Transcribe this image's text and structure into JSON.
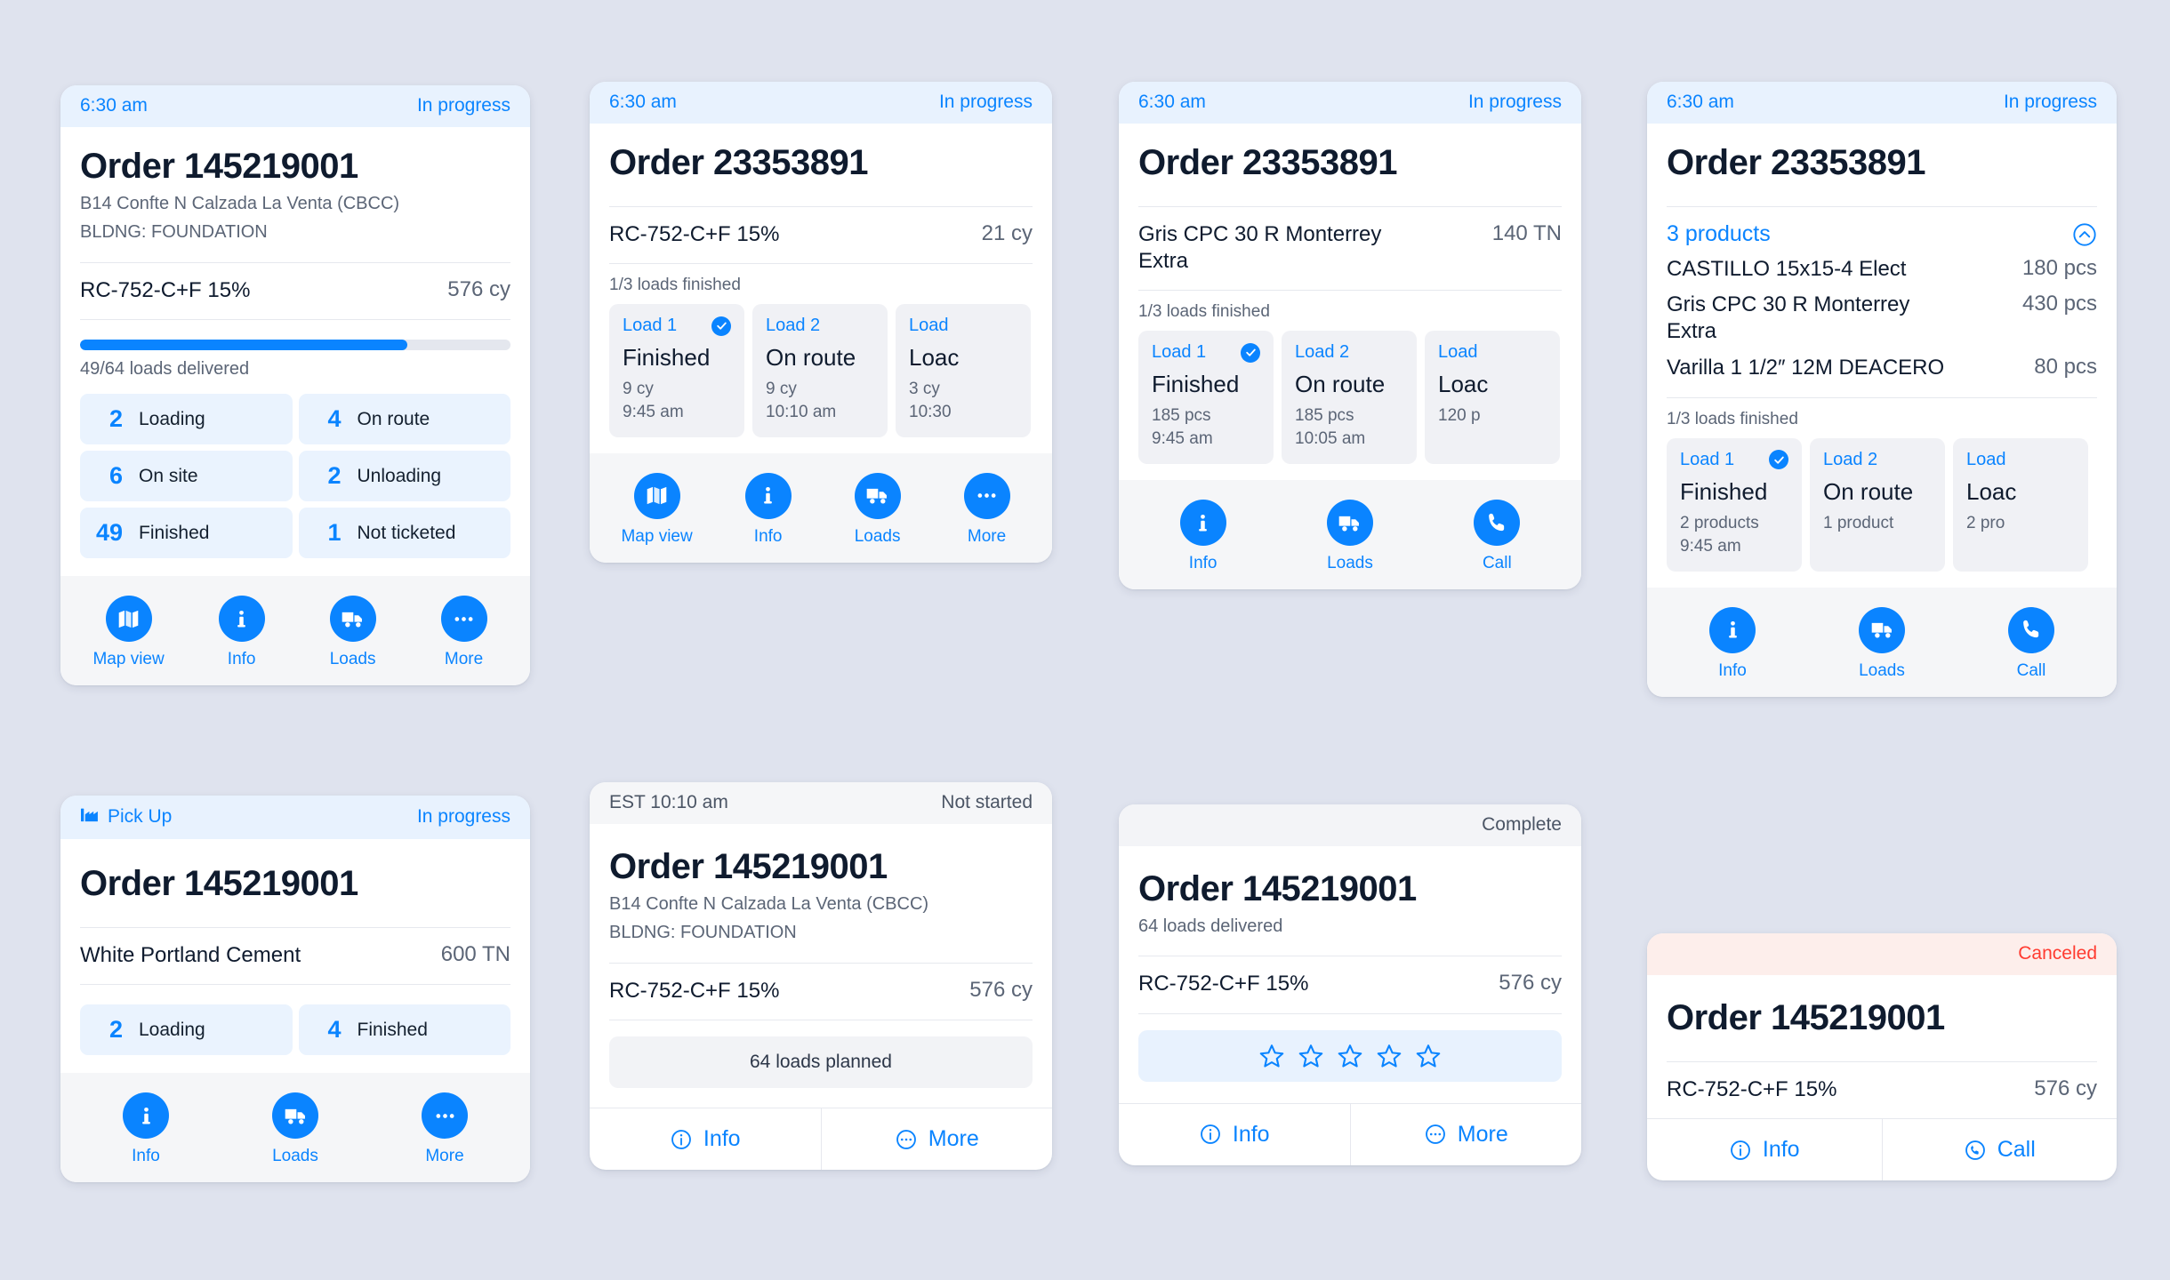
{
  "cards": {
    "order_in_progress_detail": {
      "status_time": "6:30 am",
      "status_label": "In progress",
      "title": "Order 145219001",
      "address_line1": "B14 Confte N Calzada La Venta (CBCC)",
      "address_line2": "BLDNG: FOUNDATION",
      "product": "RC-752-C+F 15%",
      "quantity": "576 cy",
      "progress_percent": 76,
      "progress_label": "49/64 loads delivered",
      "stats": [
        {
          "count": "2",
          "label": "Loading"
        },
        {
          "count": "4",
          "label": "On route"
        },
        {
          "count": "6",
          "label": "On site"
        },
        {
          "count": "2",
          "label": "Unloading"
        },
        {
          "count": "49",
          "label": "Finished"
        },
        {
          "count": "1",
          "label": "Not ticketed"
        }
      ],
      "actions": [
        {
          "label": "Map view",
          "icon": "map-icon"
        },
        {
          "label": "Info",
          "icon": "info-icon"
        },
        {
          "label": "Loads",
          "icon": "truck-icon"
        },
        {
          "label": "More",
          "icon": "ellipsis-icon"
        }
      ]
    },
    "order_loads_cy": {
      "status_time": "6:30 am",
      "status_label": "In progress",
      "title": "Order 23353891",
      "product": "RC-752-C+F 15%",
      "quantity": "21 cy",
      "loads_caption": "1/3 loads finished",
      "loads": [
        {
          "name": "Load 1",
          "status": "Finished",
          "amount": "9 cy",
          "time": "9:45 am",
          "checked": true
        },
        {
          "name": "Load 2",
          "status": "On route",
          "amount": "9 cy",
          "time": "10:10 am",
          "checked": false
        },
        {
          "name": "Load",
          "status": "Loac",
          "amount": "3 cy",
          "time": "10:30",
          "checked": false
        }
      ],
      "actions": [
        {
          "label": "Map view",
          "icon": "map-icon"
        },
        {
          "label": "Info",
          "icon": "info-icon"
        },
        {
          "label": "Loads",
          "icon": "truck-icon"
        },
        {
          "label": "More",
          "icon": "ellipsis-icon"
        }
      ]
    },
    "order_loads_pcs": {
      "status_time": "6:30 am",
      "status_label": "In progress",
      "title": "Order 23353891",
      "product": "Gris CPC 30 R Monterrey Extra",
      "quantity": "140 TN",
      "loads_caption": "1/3 loads finished",
      "loads": [
        {
          "name": "Load 1",
          "status": "Finished",
          "amount": "185 pcs",
          "time": "9:45 am",
          "checked": true
        },
        {
          "name": "Load 2",
          "status": "On route",
          "amount": "185 pcs",
          "time": "10:05 am",
          "checked": false
        },
        {
          "name": "Load",
          "status": "Loac",
          "amount": "120 p",
          "time": "",
          "checked": false
        }
      ],
      "actions": [
        {
          "label": "Info",
          "icon": "info-icon"
        },
        {
          "label": "Loads",
          "icon": "truck-icon"
        },
        {
          "label": "Call",
          "icon": "phone-icon"
        }
      ]
    },
    "order_products": {
      "status_time": "6:30 am",
      "status_label": "In progress",
      "title": "Order 23353891",
      "products_header": "3 products",
      "collapse_icon": "chevron-up-circle-icon",
      "products": [
        {
          "name": "CASTILLO 15x15-4 Elect",
          "qty": "180 pcs"
        },
        {
          "name": "Gris CPC 30 R Monterrey Extra",
          "qty": "430 pcs"
        },
        {
          "name": "Varilla 1 1/2″ 12M DEACERO",
          "qty": "80 pcs"
        }
      ],
      "loads_caption": "1/3 loads finished",
      "loads": [
        {
          "name": "Load 1",
          "status": "Finished",
          "amount": "2 products",
          "time": "9:45 am",
          "checked": true
        },
        {
          "name": "Load 2",
          "status": "On route",
          "amount": "1 product",
          "time": "",
          "checked": false
        },
        {
          "name": "Load",
          "status": "Loac",
          "amount": "2 pro",
          "time": "",
          "checked": false
        }
      ],
      "actions": [
        {
          "label": "Info",
          "icon": "info-icon"
        },
        {
          "label": "Loads",
          "icon": "truck-icon"
        },
        {
          "label": "Call",
          "icon": "phone-icon"
        }
      ]
    },
    "pickup_order": {
      "status_icon": "factory-icon",
      "status_time": "Pick Up",
      "status_label": "In progress",
      "title": "Order 145219001",
      "product": "White Portland Cement",
      "quantity": "600 TN",
      "stats": [
        {
          "count": "2",
          "label": "Loading"
        },
        {
          "count": "4",
          "label": "Finished"
        }
      ],
      "actions": [
        {
          "label": "Info",
          "icon": "info-icon"
        },
        {
          "label": "Loads",
          "icon": "truck-icon"
        },
        {
          "label": "More",
          "icon": "ellipsis-icon"
        }
      ]
    },
    "order_not_started": {
      "status_time": "EST 10:10 am",
      "status_label": "Not started",
      "title": "Order 145219001",
      "address_line1": "B14 Confte N Calzada La Venta (CBCC)",
      "address_line2": "BLDNG: FOUNDATION",
      "product": "RC-752-C+F 15%",
      "quantity": "576 cy",
      "planned_label": "64 loads planned",
      "actions": [
        {
          "label": "Info",
          "icon": "info-outline-icon"
        },
        {
          "label": "More",
          "icon": "ellipsis-outline-icon"
        }
      ]
    },
    "order_complete": {
      "status_time": "",
      "status_label": "Complete",
      "title": "Order 145219001",
      "subtitle": "64 loads delivered",
      "product": "RC-752-C+F 15%",
      "quantity": "576 cy",
      "rating_stars": 5,
      "rating_filled": 0,
      "actions": [
        {
          "label": "Info",
          "icon": "info-outline-icon"
        },
        {
          "label": "More",
          "icon": "ellipsis-outline-icon"
        }
      ]
    },
    "order_canceled": {
      "status_time": "",
      "status_label": "Canceled",
      "title": "Order 145219001",
      "product": "RC-752-C+F 15%",
      "quantity": "576 cy",
      "actions": [
        {
          "label": "Info",
          "icon": "info-outline-icon"
        },
        {
          "label": "Call",
          "icon": "phone-outline-icon"
        }
      ]
    }
  },
  "colors": {
    "accent": "#0a84ff",
    "danger": "#ff3b30",
    "page_bg": "#dfe3ee",
    "title": "#0f1b2e",
    "muted": "#5b6576"
  }
}
